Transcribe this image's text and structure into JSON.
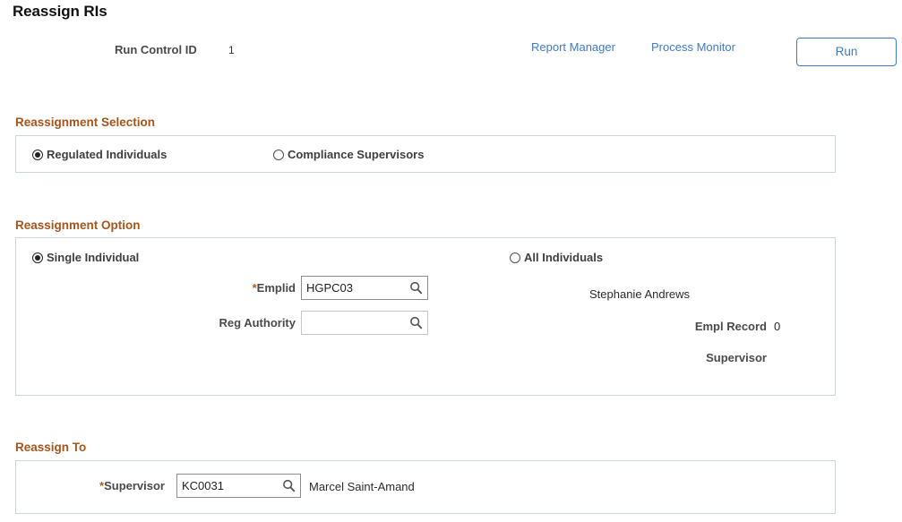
{
  "page": {
    "title": "Reassign RIs"
  },
  "run_control": {
    "label": "Run Control ID",
    "value": "1"
  },
  "toolbar": {
    "report_manager": "Report Manager",
    "process_monitor": "Process Monitor",
    "run_button": "Run"
  },
  "reassignment_selection": {
    "header": "Reassignment Selection",
    "options": [
      {
        "label": "Regulated Individuals",
        "selected": true
      },
      {
        "label": "Compliance Supervisors",
        "selected": false
      }
    ]
  },
  "reassignment_option": {
    "header": "Reassignment Option",
    "options": [
      {
        "label": "Single Individual",
        "selected": true
      },
      {
        "label": "All Individuals",
        "selected": false
      }
    ],
    "emplid": {
      "label": "*Emplid",
      "label_prefix": "*",
      "label_text": "Emplid",
      "value": "HGPC03",
      "placeholder": "",
      "lookup_icon": "search-icon"
    },
    "reg_authority": {
      "label": "Reg Authority",
      "value": "",
      "placeholder": "",
      "lookup_icon": "search-icon"
    },
    "person_name": "Stephanie Andrews",
    "empl_record": {
      "label": "Empl Record",
      "value": "0"
    },
    "supervisor": {
      "label": "Supervisor",
      "value": ""
    }
  },
  "reassign_to": {
    "header": "Reassign To",
    "supervisor": {
      "label": "*Supervisor",
      "label_prefix": "*",
      "label_text": "Supervisor",
      "value": "KC0031",
      "placeholder": "",
      "lookup_icon": "search-icon",
      "name": "Marcel Saint-Amand"
    }
  },
  "colors": {
    "section_header": "#a8541a",
    "link": "#3e7ad0",
    "panel_border": "#cdd6dd",
    "required_star": "#b55a13"
  }
}
